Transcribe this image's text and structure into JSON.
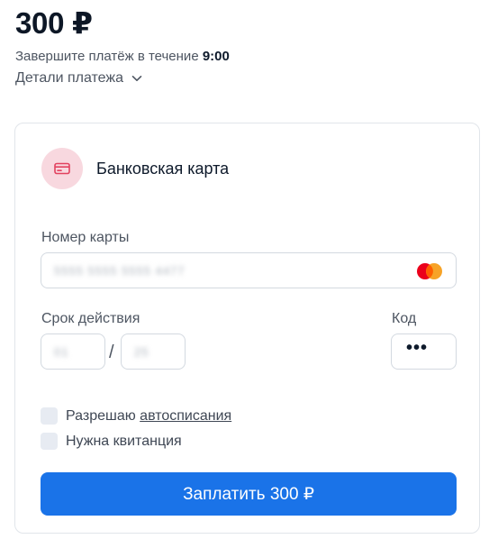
{
  "header": {
    "amount": "300 ₽",
    "deadline_prefix": "Завершите платёж в течение ",
    "deadline_time": "9:00",
    "details_label": "Детали платежа"
  },
  "payment_method": {
    "icon": "credit-card-icon",
    "label": "Банковская карта"
  },
  "form": {
    "card_number_label": "Номер карты",
    "card_number_value": "5555 5555 5555 4477",
    "card_brand_icon": "mastercard-icon",
    "expiry_label": "Срок действия",
    "expiry_month_value": "01",
    "expiry_separator": "/",
    "expiry_year_value": "25",
    "cvc_label": "Код",
    "cvc_value": "•••",
    "autopay_prefix": "Разрешаю ",
    "autopay_link": "автосписания",
    "receipt_label": "Нужна квитанция"
  },
  "pay_button": {
    "label": "Заплатить 300 ₽"
  },
  "colors": {
    "accent": "#1a73e8",
    "method_badge_bg": "#f8d8df",
    "method_icon": "#e2415f",
    "mastercard_red": "#eb001b",
    "mastercard_orange": "#f79e1b"
  }
}
